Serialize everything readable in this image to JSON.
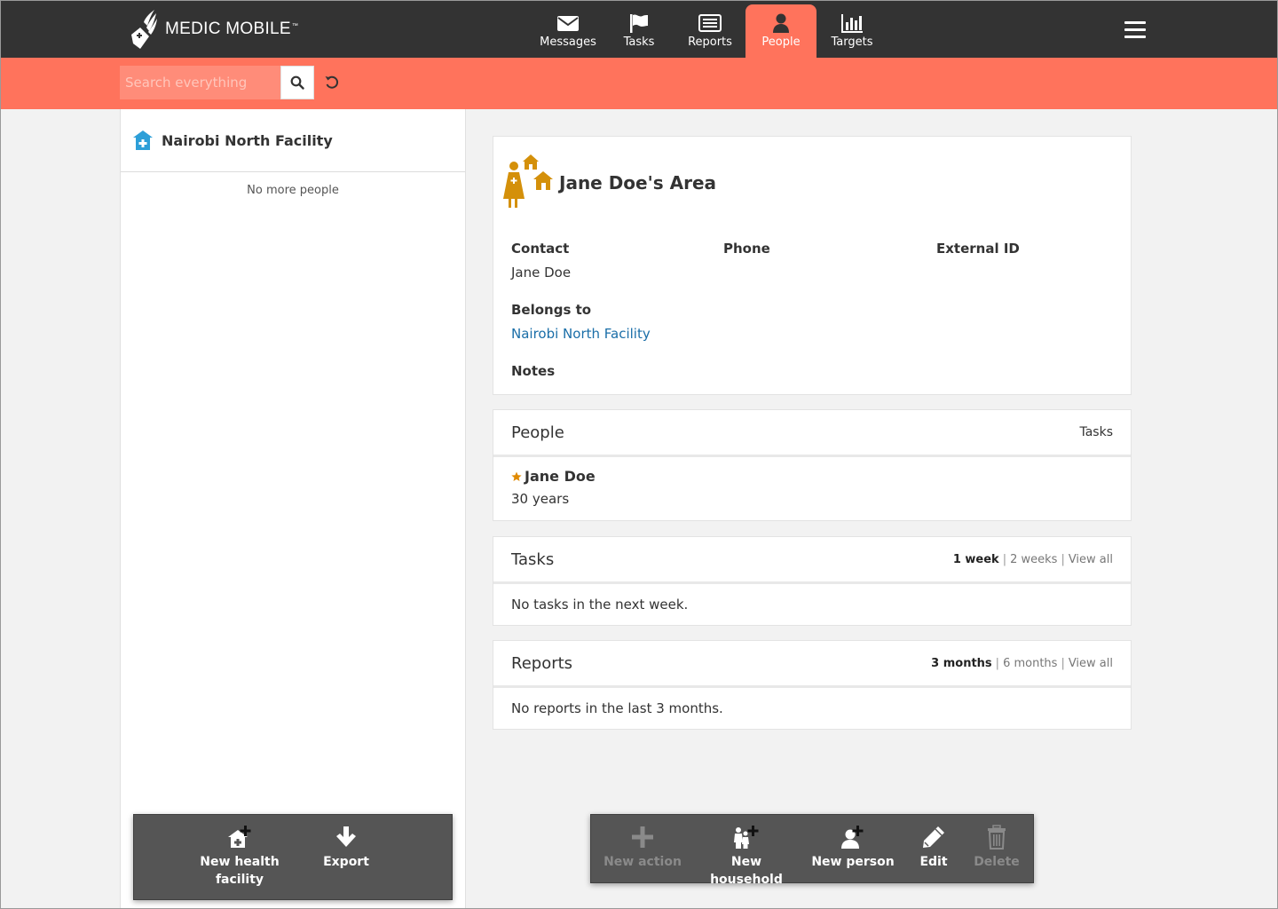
{
  "header": {
    "logo_text": "MEDIC MOBILE",
    "logo_tm": "™",
    "tabs": [
      {
        "label": "Messages",
        "icon": "envelope-icon",
        "active": false
      },
      {
        "label": "Tasks",
        "icon": "flag-icon",
        "active": false
      },
      {
        "label": "Reports",
        "icon": "list-icon",
        "active": false
      },
      {
        "label": "People",
        "icon": "person-icon",
        "active": true
      },
      {
        "label": "Targets",
        "icon": "bar-chart-icon",
        "active": false
      }
    ]
  },
  "search": {
    "placeholder": "Search everything"
  },
  "left_panel": {
    "facility_name": "Nairobi North Facility",
    "no_more": "No more people",
    "actions": [
      {
        "label": "New health facility",
        "icon": "new-facility-icon"
      },
      {
        "label": "Export",
        "icon": "download-icon"
      }
    ]
  },
  "summary": {
    "title": "Jane Doe's Area",
    "contact_label": "Contact",
    "contact_value": "Jane Doe",
    "phone_label": "Phone",
    "external_id_label": "External ID",
    "belongs_to_label": "Belongs to",
    "belongs_to_value": "Nairobi North Facility",
    "notes_label": "Notes"
  },
  "people": {
    "title": "People",
    "right_label": "Tasks",
    "items": [
      {
        "name": "Jane Doe",
        "age": "30 years",
        "primary": true
      }
    ]
  },
  "tasks": {
    "title": "Tasks",
    "filters": [
      "1 week",
      "2 weeks",
      "View all"
    ],
    "empty": "No tasks in the next week."
  },
  "reports": {
    "title": "Reports",
    "filters": [
      "3 months",
      "6 months",
      "View all"
    ],
    "empty": "No reports in the last 3 months."
  },
  "actions": [
    {
      "label": "New action",
      "icon": "plus-icon",
      "disabled": true
    },
    {
      "label": "New household",
      "icon": "new-household-icon",
      "disabled": false
    },
    {
      "label": "New person",
      "icon": "new-person-icon",
      "disabled": false
    },
    {
      "label": "Edit",
      "icon": "pencil-icon",
      "disabled": false
    },
    {
      "label": "Delete",
      "icon": "trash-icon",
      "disabled": true
    }
  ],
  "colors": {
    "header_bg": "#333333",
    "accent": "#ff735c",
    "area_icon": "#d4900a",
    "link": "#1a6ea8",
    "facility_icon": "#2d9fd8"
  }
}
